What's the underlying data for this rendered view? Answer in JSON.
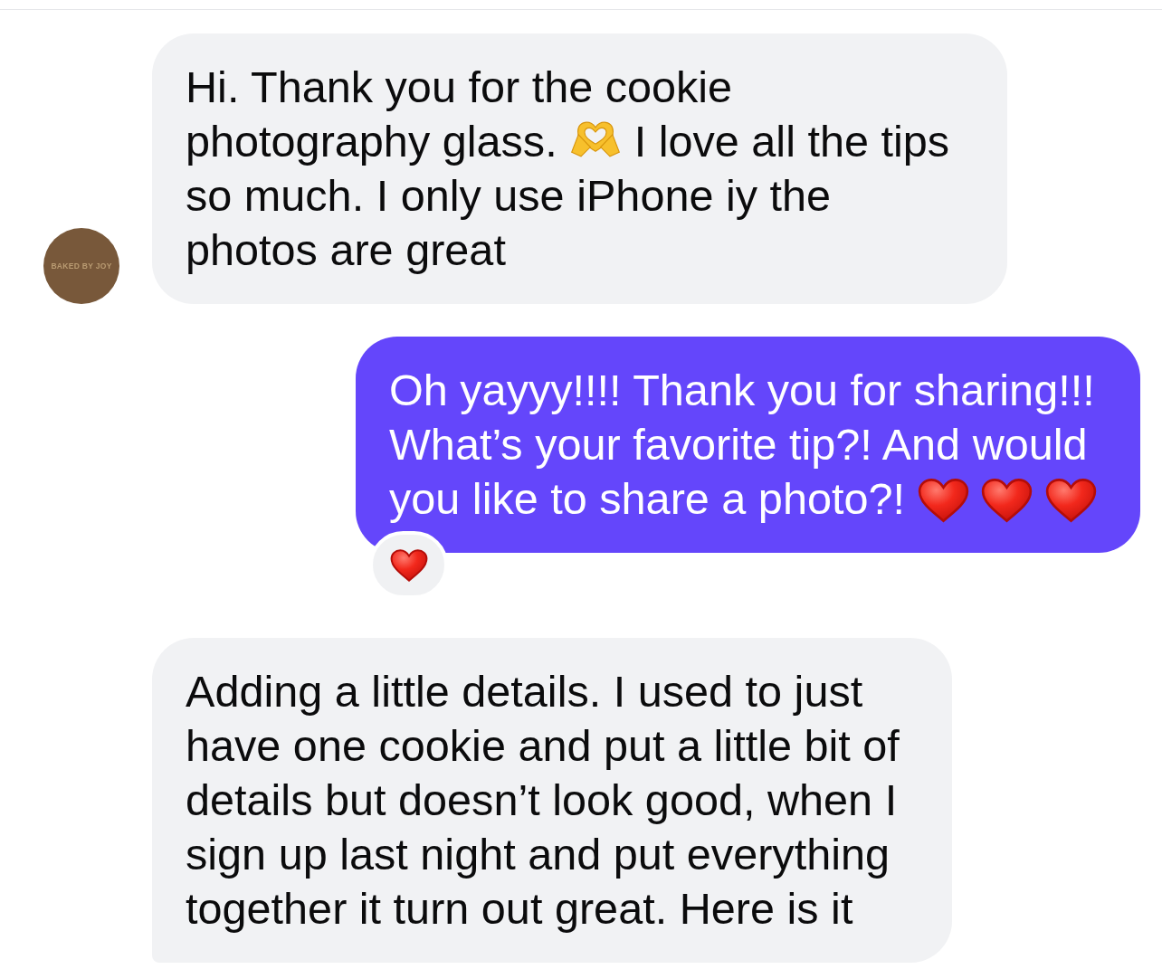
{
  "messages": [
    {
      "kind": "received",
      "avatar": {
        "label": "BAKED BY JOY"
      },
      "parts": [
        {
          "kind": "text",
          "text": "Hi. Thank you for the cookie photography glass."
        },
        {
          "kind": "heart-hands"
        },
        {
          "kind": "text",
          "text": "I love all the tips so much. I only use iPhone iy the photos are great"
        }
      ]
    },
    {
      "kind": "sent",
      "parts": [
        {
          "kind": "text",
          "text": "Oh yayyy!!!! Thank you for sharing!!! What’s your favorite tip?! And would you like to share a photo?!"
        },
        {
          "kind": "heart"
        },
        {
          "kind": "heart"
        },
        {
          "kind": "heart"
        }
      ],
      "reactions": [
        {
          "kind": "heart"
        }
      ]
    },
    {
      "kind": "received",
      "parts": [
        {
          "kind": "text",
          "text": "Adding a little details. I used to just have one cookie and put a little bit of details but doesn’t look good, when I sign up last night and put everything together it turn out great. Here is it"
        }
      ]
    }
  ]
}
